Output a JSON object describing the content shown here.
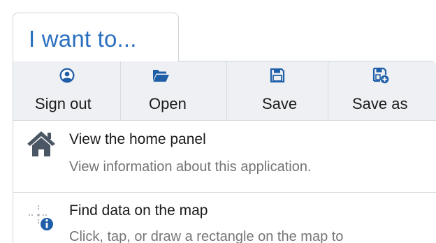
{
  "tab": {
    "label": "I want to..."
  },
  "toolbar": {
    "buttons": [
      {
        "label": "Sign out",
        "icon": "user-circle-icon"
      },
      {
        "label": "Open",
        "icon": "folder-open-icon"
      },
      {
        "label": "Save",
        "icon": "floppy-disk-icon"
      },
      {
        "label": "Save as",
        "icon": "floppy-disk-plus-icon"
      }
    ]
  },
  "items": [
    {
      "title": "View the home panel",
      "description": "View information about this application.",
      "icon": "home-icon"
    },
    {
      "title": "Find data on the map",
      "description": "Click, tap, or draw a rectangle on the map to",
      "icon": "identify-crosshair-info-icon"
    }
  ],
  "colors": {
    "accent": "#2a6fbf",
    "icon_blue": "#1f5fa8",
    "home_icon": "#4a5663",
    "toolbar_bg": "#eef0f3",
    "border": "#d8dbdf",
    "secondary_text": "#757575"
  }
}
